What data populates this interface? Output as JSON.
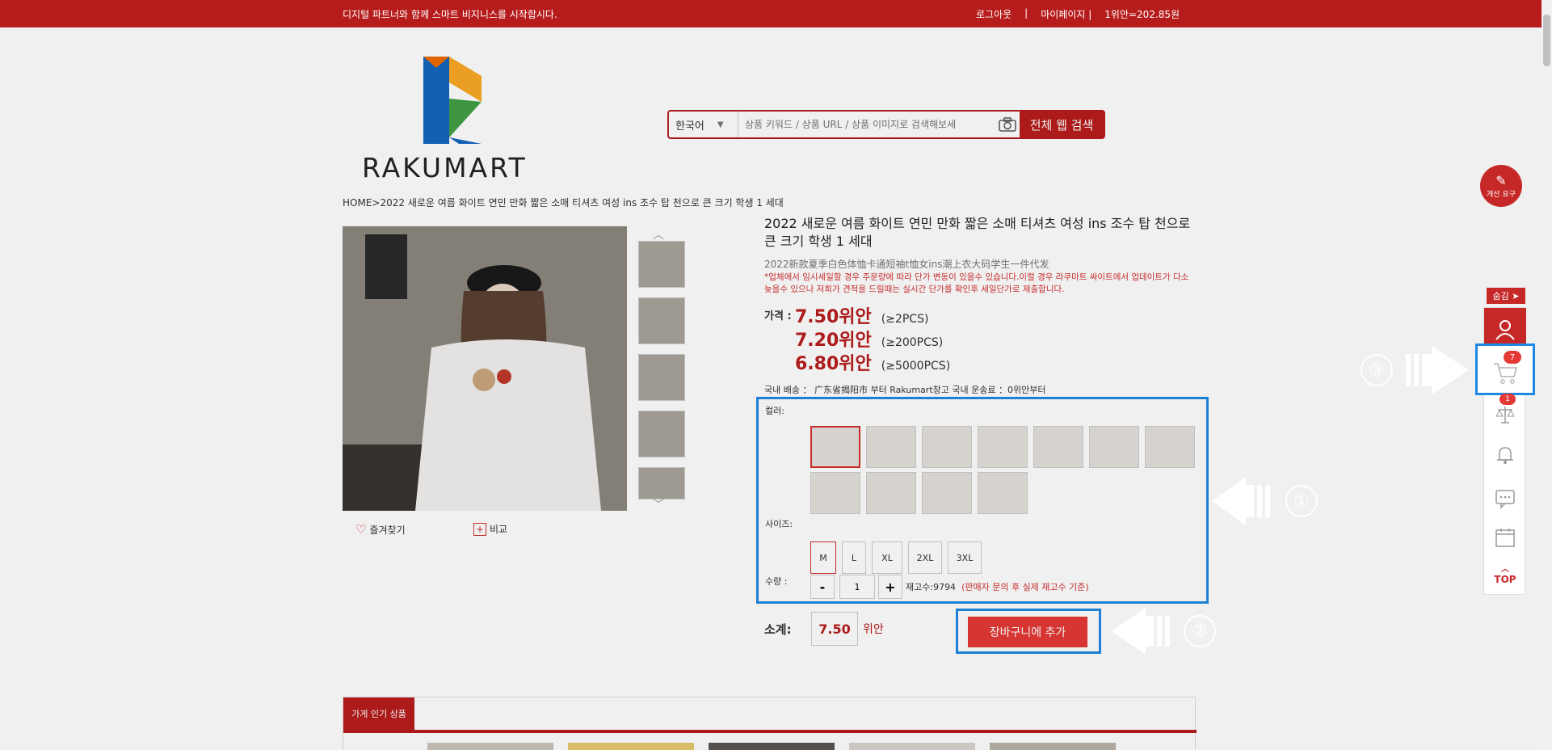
{
  "topbar": {
    "slogan": "디지털 파트너와 함께 스마트 비지니스를 시작합시다.",
    "logout": "로그아웃",
    "sep": "|",
    "mypage": "마이페이지 |",
    "rate": "1위안=202.85원"
  },
  "logo": {
    "text_a": "RAKU",
    "text_b": "MART"
  },
  "search": {
    "language": "한국어",
    "placeholder": "상품 키워드 / 상품 URL / 상품 이미지로 검색해보세",
    "button": "전체 웹 검색"
  },
  "breadcrumb": "HOME>2022 새로운 여름 화이트 연민 만화 짧은 소매 티셔츠 여성 ins 조수 탑 천으로 큰 크기 학생 1 세대",
  "gallery": {
    "favorite": "즐겨찾기",
    "compare": "비교"
  },
  "product": {
    "title": "2022 새로운 여름 화이트 연민 만화 짧은 소매 티셔츠 여성 ins 조수 탑 천으로 큰 크기 학생 1 세대",
    "subtitle": "2022新款夏季白色体恤卡通短袖t恤女ins潮上衣大码学生一件代发",
    "notice": "*업체에서 임시세일할 경우 주문량에 따라 단가 변동이 있을수 있습니다.이럴 경우 라쿠마트 싸이트에서 업데이트가 다소 늦을수 있으나 저희가 견적을 드릴때는 실시간 단가를 확인후 세일단가로 제출합니다.",
    "price_label": "가격 :",
    "prices": [
      {
        "price": "7.50위안",
        "qty": "(≥2PCS)"
      },
      {
        "price": "7.20위안",
        "qty": "(≥200PCS)"
      },
      {
        "price": "6.80위안",
        "qty": "(≥5000PCS)"
      }
    ],
    "shipping": "국내 배송 ： 广东省揭阳市 부터 Rakumart창고        국내 운송료 ：0위안부터"
  },
  "options": {
    "color_label": "컬러:",
    "size_label": "사이즈:",
    "qty_label": "수량 :",
    "sizes": [
      "M",
      "L",
      "XL",
      "2XL",
      "3XL"
    ],
    "minus": "-",
    "plus": "+",
    "qty_value": "1",
    "stock": "재고수:9794",
    "stock_note": "(판매자 문의 후 실제 재고수 기준)"
  },
  "subtotal": {
    "label": "소계:",
    "value": "7.50",
    "unit": "위안"
  },
  "cart_button": "장바구니에 추가",
  "popular_tab": "가게 인기 상품",
  "sidebar": {
    "feedback": "개선 요구",
    "hide": "숨김 ➤",
    "cart_count": "7",
    "badge": "1",
    "top": "TOP"
  },
  "annotations": [
    "①",
    "②",
    "③"
  ],
  "colors": {
    "brand": "#b71c1c",
    "highlight": "#1e88e5",
    "accent": "#e53935"
  }
}
